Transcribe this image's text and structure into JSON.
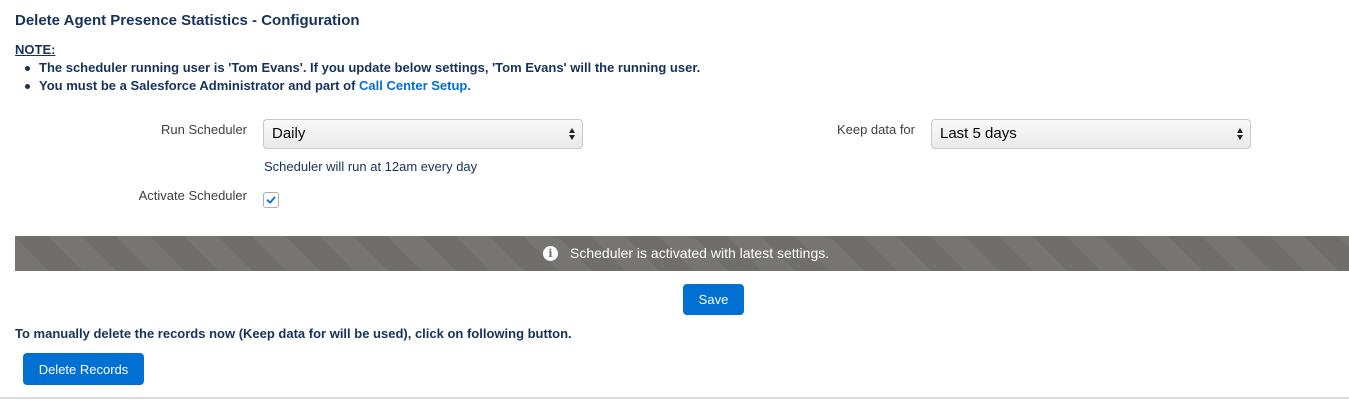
{
  "page": {
    "title": "Delete Agent Presence Statistics - Configuration"
  },
  "note": {
    "label": "NOTE:",
    "line1": "The scheduler running user is 'Tom Evans'. If you update below settings, 'Tom Evans' will the running user.",
    "line2_prefix": "You must be a Salesforce Administrator and part of ",
    "line2_link": "Call Center Setup."
  },
  "form": {
    "run_scheduler_label": "Run Scheduler",
    "run_scheduler_value": "Daily",
    "run_scheduler_helper": "Scheduler will run at 12am every day",
    "keep_data_label": "Keep data for",
    "keep_data_value": "Last 5 days",
    "activate_label": "Activate Scheduler",
    "activate_checked": true
  },
  "toast": {
    "message": "Scheduler is activated with latest settings.",
    "icon": "info-icon"
  },
  "actions": {
    "save_label": "Save",
    "manual_text": "To manually delete the records now (Keep data for will be used), click on following button.",
    "delete_label": "Delete Records"
  },
  "colors": {
    "brand_blue": "#0070d2",
    "text_navy": "#16325c",
    "toast_gray": "#706e6b"
  }
}
